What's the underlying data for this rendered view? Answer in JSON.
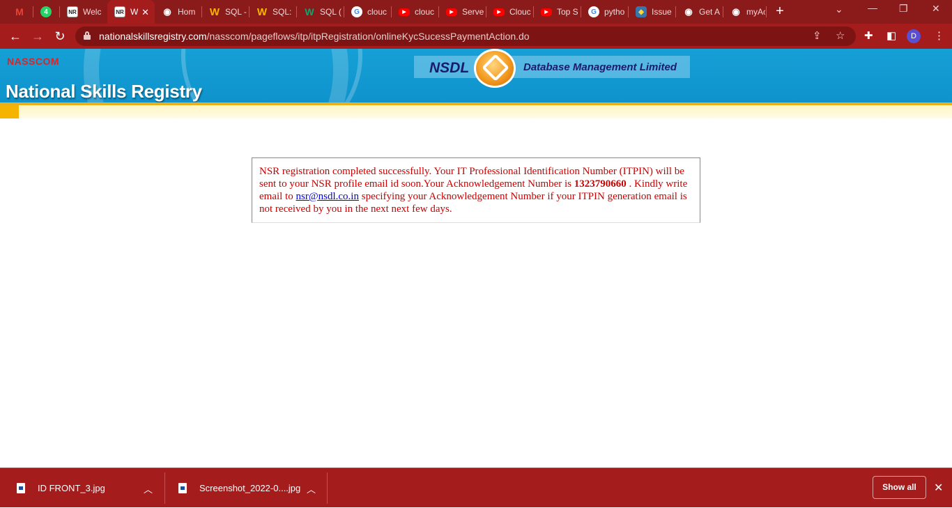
{
  "browser": {
    "tabs": [
      {
        "title": "",
        "icon": "gmail-icon"
      },
      {
        "title": "",
        "icon": "whatsapp-icon"
      },
      {
        "title": "Welc",
        "icon": "nsr-icon"
      },
      {
        "title": "W",
        "icon": "nsr-icon",
        "active": true
      },
      {
        "title": "Hom",
        "icon": "wifi-icon"
      },
      {
        "title": "SQL -",
        "icon": "w-icon"
      },
      {
        "title": "SQL:",
        "icon": "w-icon"
      },
      {
        "title": "SQL (",
        "icon": "w3-icon"
      },
      {
        "title": "clouc",
        "icon": "google-icon"
      },
      {
        "title": "clouc",
        "icon": "youtube-icon"
      },
      {
        "title": "Serve",
        "icon": "youtube-icon"
      },
      {
        "title": "Clouc",
        "icon": "youtube-icon"
      },
      {
        "title": "Top S",
        "icon": "youtube-icon"
      },
      {
        "title": "pytho",
        "icon": "google-icon"
      },
      {
        "title": "Issue",
        "icon": "python-icon"
      },
      {
        "title": "Get A",
        "icon": "wifi-icon"
      },
      {
        "title": "myAc",
        "icon": "wifi-icon"
      }
    ],
    "whatsapp_badge": "4",
    "url_domain": "nationalskillsregistry.com",
    "url_path": "/nasscom/pageflows/itp/itpRegistration/onlineKycSucessPaymentAction.do",
    "profile_initial": "D",
    "theme_color": "#a51c1c"
  },
  "header": {
    "brand_small": "NASSCOM",
    "title": "National Skills Registry",
    "nsdl_name": "NSDL",
    "nsdl_tagline": "Database Management Limited"
  },
  "message": {
    "part1": "NSR registration completed successfully. Your IT Professional Identification Number (ITPIN) will be sent to your NSR profile email id soon.Your Acknowledgement Number is ",
    "ack_number": "1323790660",
    "part2": " . Kindly write email to ",
    "email": "nsr@nsdl.co.in",
    "part3": " specifying your Acknowledgement Number if your ITPIN generation email is not received by you in the next next few days."
  },
  "downloads": {
    "items": [
      {
        "name": "ID FRONT_3.jpg"
      },
      {
        "name": "Screenshot_2022-0....jpg"
      }
    ],
    "show_all_label": "Show all"
  }
}
